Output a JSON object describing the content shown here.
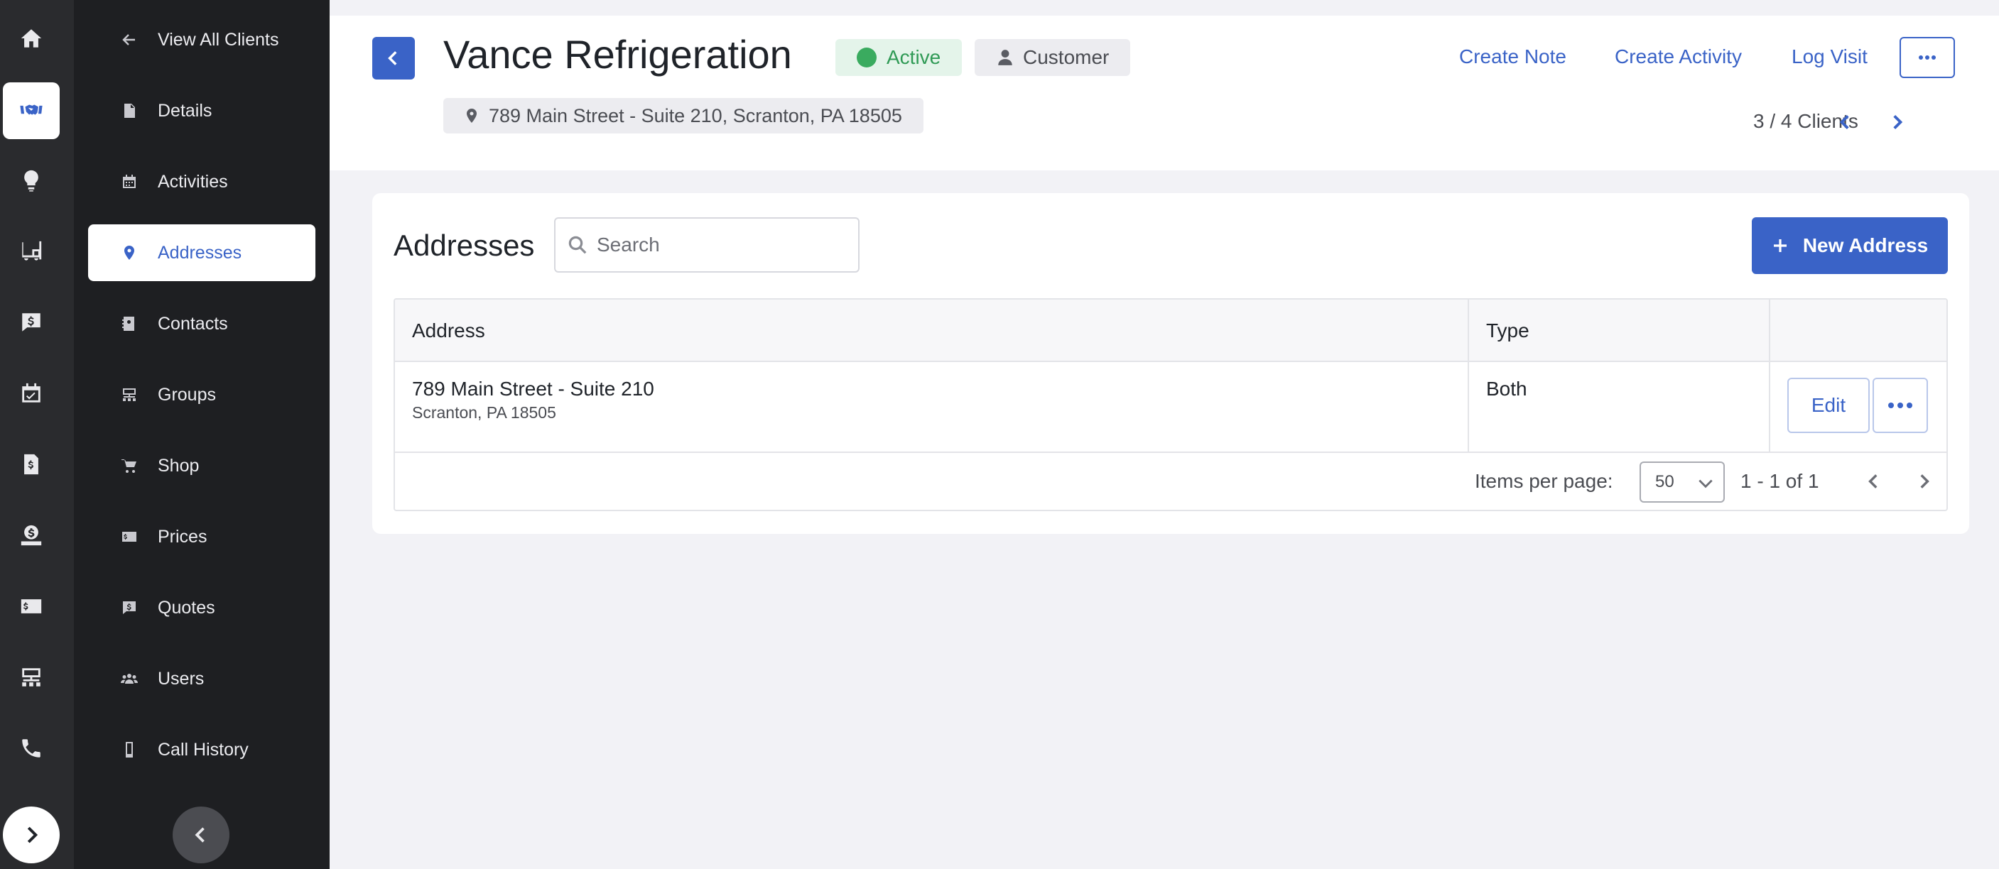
{
  "colors": {
    "accent": "#3a63c7",
    "active_green": "#3aab5f",
    "sidebar_bg": "#1e1f22",
    "rail_bg": "#2a2b2e"
  },
  "rail": {
    "items": [
      {
        "icon": "home-icon"
      },
      {
        "icon": "handshake-icon",
        "active": true
      },
      {
        "icon": "lightbulb-icon"
      },
      {
        "icon": "forklift-icon"
      },
      {
        "icon": "dollar-message-icon"
      },
      {
        "icon": "calendar-check-icon"
      },
      {
        "icon": "invoice-icon"
      },
      {
        "icon": "money-hand-icon"
      },
      {
        "icon": "dollar-card-icon"
      },
      {
        "icon": "org-chart-icon"
      },
      {
        "icon": "phone-icon"
      }
    ],
    "expand_icon": "chevron-right-icon"
  },
  "sidebar": {
    "back_label": "View All Clients",
    "items": [
      {
        "label": "Details",
        "icon": "document-icon"
      },
      {
        "label": "Activities",
        "icon": "calendar-icon"
      },
      {
        "label": "Addresses",
        "icon": "map-pin-icon",
        "active": true
      },
      {
        "label": "Contacts",
        "icon": "contact-book-icon"
      },
      {
        "label": "Groups",
        "icon": "org-chart-icon"
      },
      {
        "label": "Shop",
        "icon": "cart-icon"
      },
      {
        "label": "Prices",
        "icon": "dollar-card-icon"
      },
      {
        "label": "Quotes",
        "icon": "dollar-message-icon"
      },
      {
        "label": "Users",
        "icon": "users-icon"
      },
      {
        "label": "Call History",
        "icon": "mobile-phone-icon"
      }
    ],
    "collapse_icon": "chevron-left-icon"
  },
  "header": {
    "client_name": "Vance Refrigeration",
    "status": "Active",
    "client_type": "Customer",
    "address": "789 Main Street - Suite 210, Scranton, PA 18505",
    "actions": {
      "create_note": "Create Note",
      "create_activity": "Create Activity",
      "log_visit": "Log Visit"
    },
    "pager": "3 / 4 Clients"
  },
  "addresses": {
    "title": "Addresses",
    "search_placeholder": "Search",
    "new_button": "New Address",
    "columns": {
      "address": "Address",
      "type": "Type"
    },
    "rows": [
      {
        "line1": "789 Main Street - Suite 210",
        "line2": "Scranton, PA 18505",
        "type": "Both",
        "edit_label": "Edit"
      }
    ],
    "footer": {
      "items_per_page_label": "Items per page:",
      "items_per_page": "50",
      "range": "1 - 1 of 1"
    }
  }
}
